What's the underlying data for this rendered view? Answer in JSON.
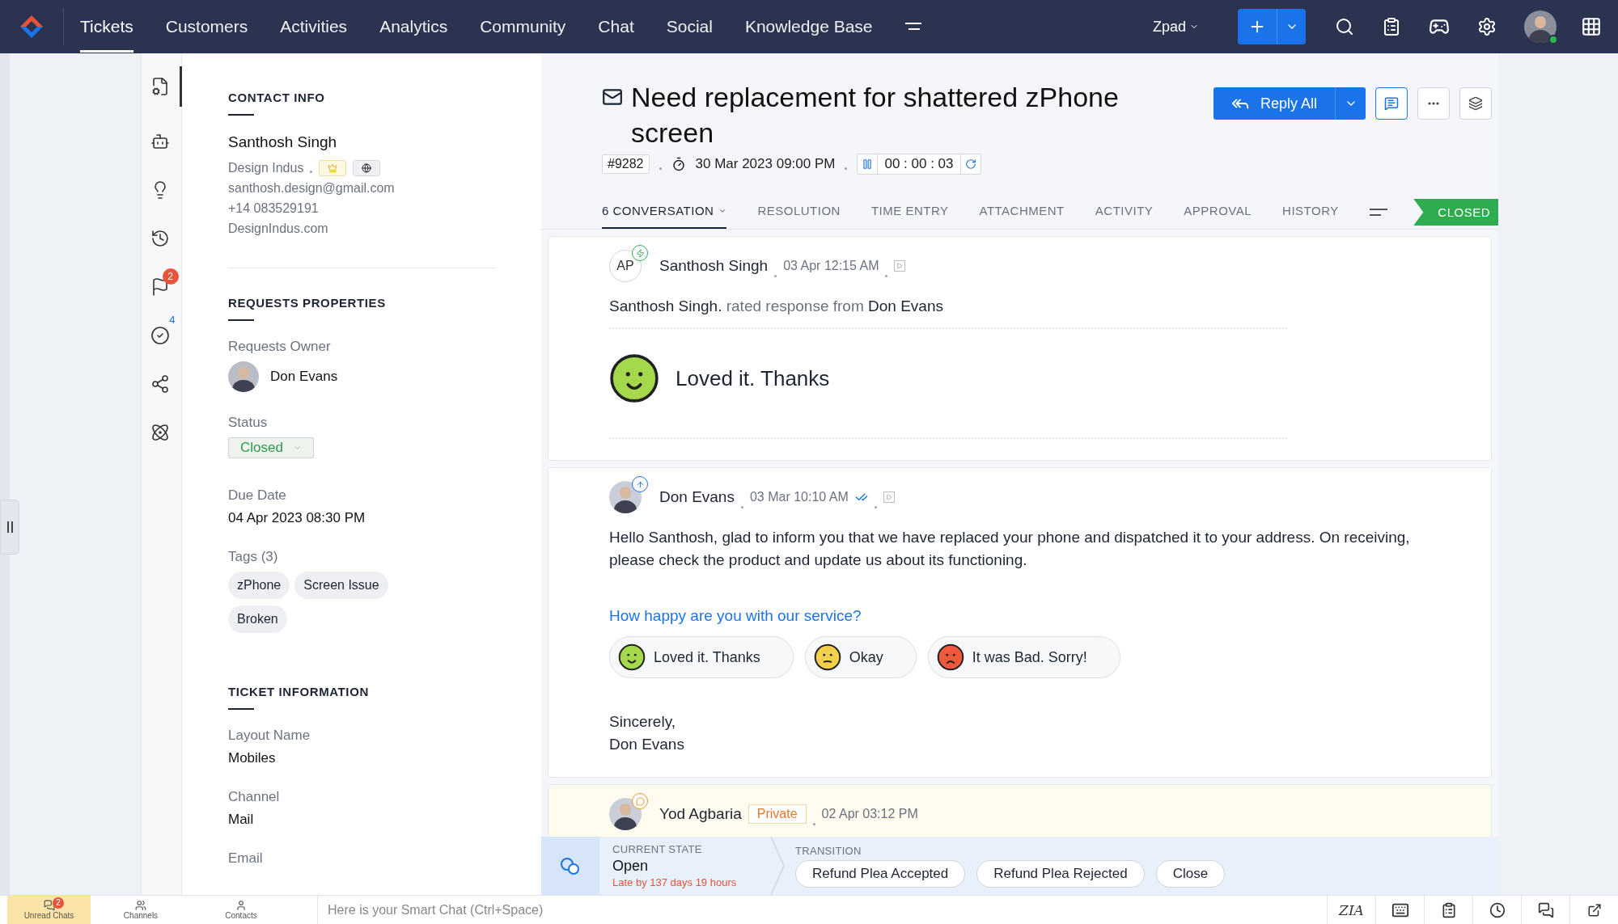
{
  "top_nav": {
    "items": [
      {
        "label": "Tickets",
        "selected": true
      },
      {
        "label": "Customers",
        "selected": false
      },
      {
        "label": "Activities",
        "selected": false
      },
      {
        "label": "Analytics",
        "selected": false
      },
      {
        "label": "Community",
        "selected": false
      },
      {
        "label": "Chat",
        "selected": false
      },
      {
        "label": "Social",
        "selected": false
      },
      {
        "label": "Knowledge Base",
        "selected": false
      }
    ],
    "department": "Zpad"
  },
  "rail": [
    {
      "selected": true
    },
    {
      "selected": false
    },
    {
      "selected": false
    },
    {
      "selected": false
    },
    {
      "selected": false,
      "badge": {
        "kind": "count",
        "text": "2"
      }
    },
    {
      "selected": false,
      "badge": {
        "kind": "plain",
        "text": "4"
      }
    },
    {
      "selected": false
    },
    {
      "selected": false
    }
  ],
  "contact": {
    "heading": "CONTACT INFO",
    "name": "Santhosh Singh",
    "company": "Design Indus",
    "email": "santhosh.design@gmail.com",
    "phone": "+14 083529191",
    "website": "DesignIndus.com"
  },
  "properties": {
    "heading": "REQUESTS PROPERTIES",
    "owner_label": "Requests Owner",
    "owner": "Don Evans",
    "status_label": "Status",
    "status": "Closed",
    "due_label": "Due Date",
    "due": "04 Apr 2023 08:30 PM",
    "tags_label": "Tags (3)",
    "tags": [
      "zPhone",
      "Screen Issue",
      "Broken"
    ]
  },
  "ticket_info": {
    "heading": "TICKET INFORMATION",
    "fields": [
      {
        "label": "Layout Name",
        "value": "Mobiles"
      },
      {
        "label": "Channel",
        "value": "Mail"
      },
      {
        "label": "Email"
      }
    ]
  },
  "ticket": {
    "title": "Need replacement for shattered zPhone screen",
    "number": "#9282",
    "created": "30 Mar 2023 09:00 PM",
    "timer": "00 : 00 : 03",
    "reply_button": "Reply All",
    "status_badge": "CLOSED"
  },
  "tabs": [
    {
      "label": "6 CONVERSATION",
      "selected": true
    },
    {
      "label": "RESOLUTION",
      "selected": false
    },
    {
      "label": "TIME ENTRY",
      "selected": false
    },
    {
      "label": "ATTACHMENT",
      "selected": false
    },
    {
      "label": "ACTIVITY",
      "selected": false
    },
    {
      "label": "APPROVAL",
      "selected": false
    },
    {
      "label": "HISTORY",
      "selected": false
    }
  ],
  "conversations": [
    {
      "kind": "rating",
      "initials": "AP",
      "author": "Santhosh Singh",
      "time": "03 Apr 12:15 AM",
      "line": "Santhosh Singh. **rated response from** Don Evans",
      "rating": "Loved it. Thanks"
    },
    {
      "kind": "reply",
      "author": "Don Evans",
      "time": "03 Mar 10:10 AM",
      "body": "Hello Santhosh, glad to inform you that we have replaced your phone and dispatched it to your address. On receiving, please check the product and update us about its functioning.",
      "question": "How happy are you with our service?",
      "options": [
        {
          "kind": "happy",
          "label": "Loved it. Thanks"
        },
        {
          "kind": "neutral",
          "label": "Okay"
        },
        {
          "kind": "sad",
          "label": "It was Bad. Sorry!"
        }
      ],
      "closing": [
        "Sincerely,",
        "Don Evans"
      ]
    },
    {
      "kind": "private",
      "author": "Yod Agbaria",
      "tag": "Private",
      "time": "02 Apr 03:12 PM"
    }
  ],
  "transition": {
    "state_label": "CURRENT STATE",
    "state": "Open",
    "late": "Late by 137 days 19 hours",
    "transition_label": "TRANSITION",
    "buttons": [
      "Refund Plea Accepted",
      "Refund Plea Rejected",
      "Close"
    ]
  },
  "bottom_bar": {
    "tabs": [
      {
        "label": "Unread Chats",
        "selected": true,
        "badge": "2"
      },
      {
        "label": "Channels",
        "selected": false
      },
      {
        "label": "Contacts",
        "selected": false
      }
    ],
    "chat_placeholder": "Here is your Smart Chat (Ctrl+Space)",
    "za": "ZIA"
  }
}
